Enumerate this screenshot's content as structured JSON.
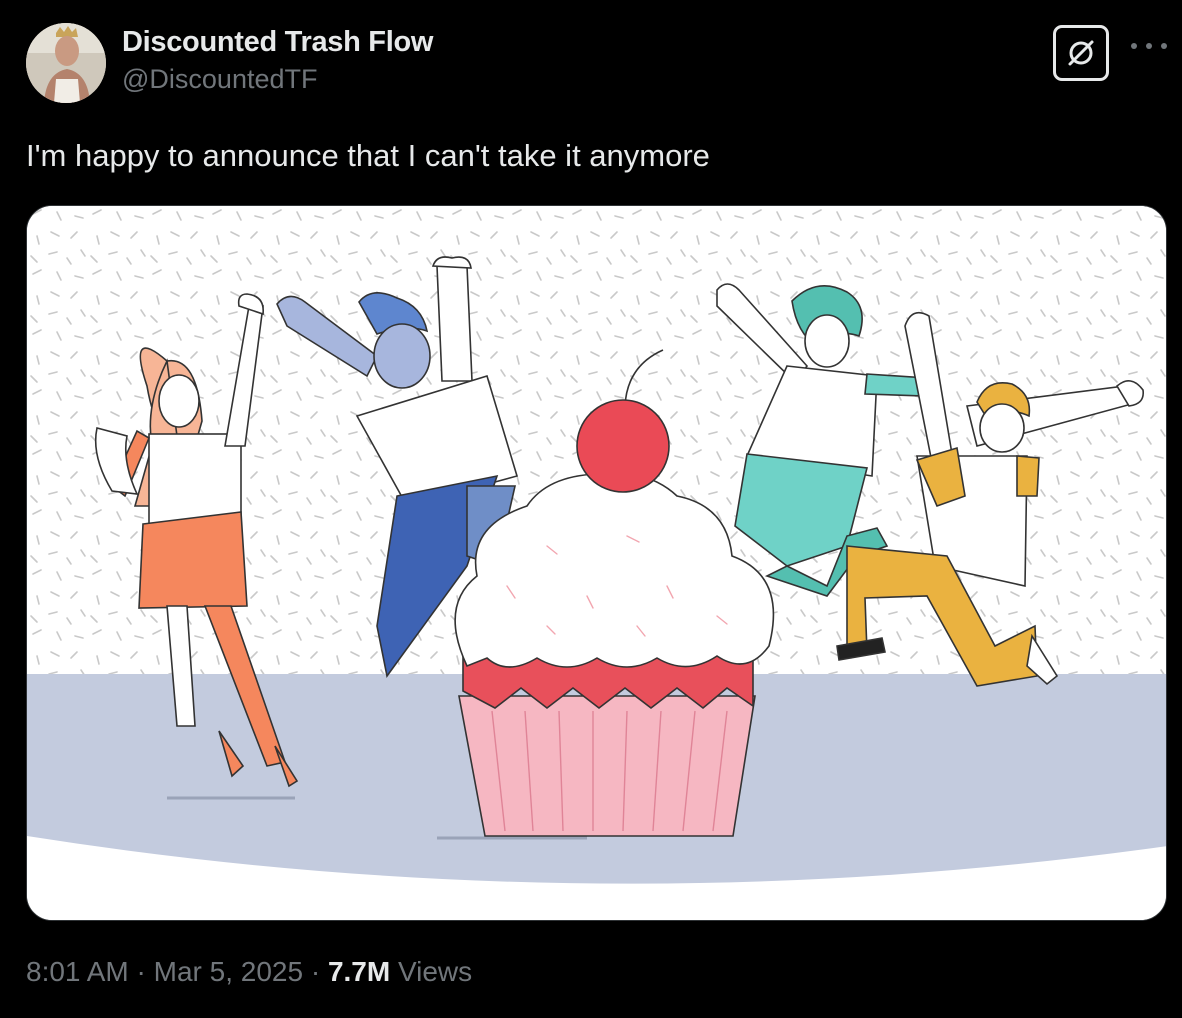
{
  "author": {
    "display_name": "Discounted Trash Flow",
    "handle": "@DiscountedTF",
    "avatar_icon": "profile-photo"
  },
  "actions": {
    "grok_icon": "grok-icon",
    "more_icon": "more-dots-icon"
  },
  "tweet": {
    "text": "I'm happy to announce that I can't take it anymore"
  },
  "media": {
    "kind": "illustration",
    "colors": {
      "cherry": "#ea4a56",
      "frosting_band": "#e8505b",
      "wrapper": "#f6b7c2",
      "floor": "#c3cbde",
      "woman_orange": "#f5875d",
      "man_blue": "#3e63b4",
      "woman_teal": "#6fd2c7",
      "man_yellow": "#eab240"
    }
  },
  "meta": {
    "time": "8:01 AM",
    "sep1": " · ",
    "date": "Mar 5, 2025",
    "sep2": " · ",
    "views_count": "7.7M",
    "views_label": " Views"
  }
}
